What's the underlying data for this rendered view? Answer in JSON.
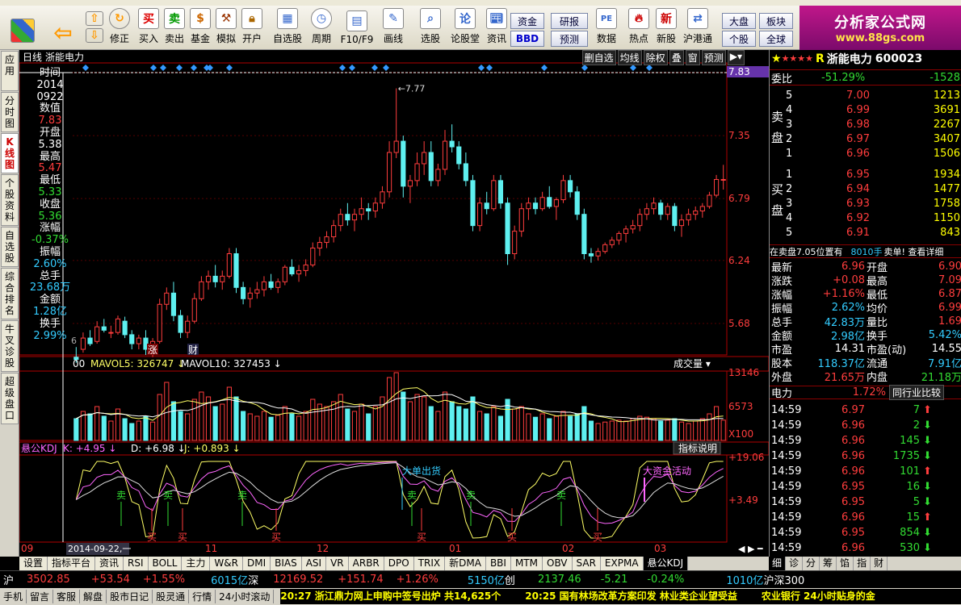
{
  "toolbar": {
    "buttons": [
      "买入",
      "卖出",
      "基金",
      "模拟",
      "开户",
      "自选股",
      "周期",
      "F10/F9",
      "画线",
      "选股",
      "论股堂",
      "资讯",
      "数据",
      "热点",
      "新股",
      "沪港通"
    ],
    "nav_buttons": [
      "修正"
    ],
    "small_buttons": [
      "资金",
      "BBD",
      "研报",
      "预测",
      "大盘",
      "板块",
      "个股",
      "全球"
    ],
    "brand_title": "分析家公式网",
    "brand_url": "www.88gs.com"
  },
  "left_tabs": [
    "应用",
    "分时图",
    "K线图",
    "个股资料",
    "自选股",
    "综合排名",
    "牛叉诊股",
    "超级盘口"
  ],
  "chart": {
    "period": "日线",
    "stock_name": "浙能电力",
    "tools": [
      "删自选",
      "均线",
      "除权",
      "叠",
      "窗",
      "预测"
    ],
    "current_price_label": "7.83",
    "high_marker": "7.77",
    "price_axis": [
      "7.91",
      "7.35",
      "6.79",
      "6.24",
      "5.68"
    ],
    "vol_axis": [
      "13146",
      "6573",
      "X100"
    ],
    "kdj_axis": [
      "+19.06",
      "+3.49"
    ],
    "date_labels": [
      "09",
      "11",
      "12",
      "01",
      "02",
      "03"
    ],
    "cursor_date": "2014-09-22,一",
    "vol_legend": {
      "mavol5": "MAVOL5: 326747",
      "mavol10": "MAVOL10: 327453",
      "title": "成交量",
      "prefix": "00"
    },
    "kdj_legend": {
      "name": "悬公KDJ",
      "k": "K: +4.95",
      "d": "D: +6.98",
      "j": "J: +0.893",
      "explain": "指标说明"
    },
    "sell_labels": [
      "卖",
      "卖",
      "卖",
      "卖",
      "卖",
      "卖"
    ],
    "buy_labels": [
      "买",
      "买",
      "买",
      "买",
      "买",
      "买"
    ],
    "annotations": [
      "大单出货",
      "大资金活动"
    ],
    "markers": [
      "涨",
      "财"
    ],
    "left_digit": "6"
  },
  "tooltip": {
    "time_label": "时间",
    "date1": "2014",
    "date2": "0922",
    "value_label": "数值",
    "value": "7.83",
    "open_label": "开盘",
    "open": "5.38",
    "high_label": "最高",
    "high": "5.47",
    "low_label": "最低",
    "low": "5.33",
    "close_label": "收盘",
    "close": "5.36",
    "change_label": "涨幅",
    "change": "-0.37%",
    "amp_label": "振幅",
    "amp": "2.60%",
    "vol_label": "总手",
    "vol": "23.68万",
    "amount_label": "金额",
    "amount": "1.28亿",
    "turn_label": "换手",
    "turn": "2.99%"
  },
  "bottom_tabs": [
    "设置",
    "指标平台",
    "资讯",
    "RSI",
    "BOLL",
    "主力",
    "W&R",
    "DMI",
    "BIAS",
    "ASI",
    "VR",
    "ARBR",
    "DPO",
    "TRIX",
    "新DMA",
    "BBI",
    "MTM",
    "OBV",
    "SAR",
    "EXPMA",
    "悬公KDJ"
  ],
  "quote": {
    "title": "浙能电力",
    "code": "600023",
    "weibi_label": "委比",
    "weibi": "-51.29%",
    "weicha": "-1528",
    "sell_label": "卖盘",
    "buy_label": "买盘",
    "asks": [
      {
        "lvl": "5",
        "p": "7.00",
        "v": "1213"
      },
      {
        "lvl": "4",
        "p": "6.99",
        "v": "3691"
      },
      {
        "lvl": "3",
        "p": "6.98",
        "v": "2267"
      },
      {
        "lvl": "2",
        "p": "6.97",
        "v": "3407"
      },
      {
        "lvl": "1",
        "p": "6.96",
        "v": "1506"
      }
    ],
    "bids": [
      {
        "lvl": "1",
        "p": "6.95",
        "v": "1934"
      },
      {
        "lvl": "2",
        "p": "6.94",
        "v": "1477"
      },
      {
        "lvl": "3",
        "p": "6.93",
        "v": "1758"
      },
      {
        "lvl": "4",
        "p": "6.92",
        "v": "1150"
      },
      {
        "lvl": "5",
        "p": "6.91",
        "v": "843"
      }
    ],
    "note": "在卖盘7.05位置有",
    "note_vol": "8010手",
    "note_end": "卖单! 查看详细",
    "stats": [
      [
        "最新",
        "6.96",
        "开盘",
        "6.90"
      ],
      [
        "涨跌",
        "+0.08",
        "最高",
        "7.09"
      ],
      [
        "涨幅",
        "+1.16%",
        "最低",
        "6.87"
      ],
      [
        "振幅",
        "2.62%",
        "均价",
        "6.99"
      ],
      [
        "总手",
        "42.83万",
        "量比",
        "1.69"
      ],
      [
        "金额",
        "2.98亿",
        "换手",
        "5.42%"
      ],
      [
        "市盈",
        "14.31",
        "市盈(动)",
        "14.55"
      ],
      [
        "股本",
        "118.37亿",
        "流通",
        "7.91亿"
      ],
      [
        "外盘",
        "21.65万",
        "内盘",
        "21.18万"
      ]
    ],
    "sector": "电力",
    "sector_change": "1.72%",
    "compare": "同行业比较",
    "ticks": [
      {
        "t": "14:59",
        "p": "6.97",
        "v": "7",
        "d": "up"
      },
      {
        "t": "14:59",
        "p": "6.96",
        "v": "2",
        "d": "down"
      },
      {
        "t": "14:59",
        "p": "6.96",
        "v": "145",
        "d": "down"
      },
      {
        "t": "14:59",
        "p": "6.96",
        "v": "1735",
        "d": "down"
      },
      {
        "t": "14:59",
        "p": "6.96",
        "v": "101",
        "d": "up"
      },
      {
        "t": "14:59",
        "p": "6.95",
        "v": "16",
        "d": "down"
      },
      {
        "t": "14:59",
        "p": "6.95",
        "v": "5",
        "d": "down"
      },
      {
        "t": "14:59",
        "p": "6.96",
        "v": "15",
        "d": "up"
      },
      {
        "t": "14:59",
        "p": "6.95",
        "v": "854",
        "d": "down"
      },
      {
        "t": "14:59",
        "p": "6.96",
        "v": "530",
        "d": "down"
      }
    ],
    "tabs": [
      "细",
      "诊",
      "分",
      "筹",
      "馅",
      "指",
      "财"
    ]
  },
  "status": {
    "sh_label": "沪",
    "sh": "3502.85",
    "sh_chg": "+53.54",
    "sh_pct": "+1.55%",
    "sh_amt": "6015亿",
    "sz_label": "深",
    "sz": "12169.52",
    "sz_chg": "+151.74",
    "sz_pct": "+1.26%",
    "sz_amt": "5150亿",
    "cy_label": "创",
    "cy": "2137.46",
    "cy_chg": "-5.21",
    "cy_pct": "-0.24%",
    "cy_amt": "1010亿",
    "hs_label": "沪深300"
  },
  "bottombar": {
    "items": [
      "手机",
      "留言",
      "客服",
      "解盘",
      "股市日记",
      "股灵通",
      "行情",
      "24小时滚动"
    ],
    "news": [
      "20:27 浙江鼎力网上申购中签号出炉 共14,625个",
      "20:25 国有林场改革方案印发 林业类企业望受益",
      "农业银行 24小时贴身的金"
    ]
  },
  "colors": {
    "up": "#ff3d3d",
    "down": "#5ef0f0",
    "bg": "#000000",
    "axis": "#b00000"
  },
  "chart_data": {
    "type": "candlestick",
    "title": "浙能电力 日线",
    "symbol": "600023",
    "x_labels": [
      "09",
      "11",
      "12",
      "01",
      "02",
      "03"
    ],
    "ylim": [
      5.4,
      7.91
    ],
    "candles": [
      [
        5.38,
        5.47,
        5.33,
        5.36
      ],
      [
        5.45,
        5.6,
        5.42,
        5.55
      ],
      [
        5.55,
        5.62,
        5.48,
        5.5
      ],
      [
        5.52,
        5.7,
        5.5,
        5.65
      ],
      [
        5.65,
        5.72,
        5.6,
        5.62
      ],
      [
        5.6,
        5.66,
        5.55,
        5.6
      ],
      [
        5.6,
        5.75,
        5.58,
        5.72
      ],
      [
        5.7,
        5.74,
        5.55,
        5.58
      ],
      [
        5.58,
        5.62,
        5.45,
        5.5
      ],
      [
        5.5,
        5.58,
        5.45,
        5.55
      ],
      [
        5.55,
        5.62,
        5.4,
        5.45
      ],
      [
        5.45,
        5.55,
        5.38,
        5.52
      ],
      [
        5.52,
        5.9,
        5.5,
        5.85
      ],
      [
        5.85,
        6.0,
        5.8,
        5.95
      ],
      [
        5.95,
        6.05,
        5.7,
        5.75
      ],
      [
        5.75,
        5.8,
        5.55,
        5.6
      ],
      [
        5.6,
        5.75,
        5.55,
        5.7
      ],
      [
        5.7,
        5.95,
        5.68,
        5.9
      ],
      [
        5.9,
        6.1,
        5.88,
        6.05
      ],
      [
        6.05,
        6.15,
        5.98,
        6.1
      ],
      [
        6.1,
        6.2,
        6.0,
        6.05
      ],
      [
        6.05,
        6.15,
        5.98,
        6.1
      ],
      [
        6.1,
        6.35,
        6.08,
        6.3
      ],
      [
        6.3,
        6.35,
        5.95,
        6.0
      ],
      [
        6.0,
        6.05,
        5.85,
        5.9
      ],
      [
        5.9,
        6.0,
        5.82,
        5.95
      ],
      [
        5.95,
        6.05,
        5.9,
        5.98
      ],
      [
        5.98,
        6.1,
        5.92,
        6.05
      ],
      [
        6.05,
        6.12,
        5.98,
        6.0
      ],
      [
        6.0,
        6.08,
        5.95,
        6.05
      ],
      [
        6.05,
        6.2,
        6.02,
        6.18
      ],
      [
        6.18,
        6.25,
        6.1,
        6.12
      ],
      [
        6.12,
        6.2,
        6.05,
        6.15
      ],
      [
        6.15,
        6.25,
        6.1,
        6.2
      ],
      [
        6.2,
        6.4,
        6.18,
        6.35
      ],
      [
        6.35,
        6.45,
        6.28,
        6.4
      ],
      [
        6.4,
        6.5,
        6.35,
        6.45
      ],
      [
        6.45,
        6.6,
        6.4,
        6.55
      ],
      [
        6.55,
        6.7,
        6.5,
        6.65
      ],
      [
        6.65,
        6.75,
        6.55,
        6.6
      ],
      [
        6.6,
        6.7,
        6.5,
        6.65
      ],
      [
        6.65,
        6.8,
        6.6,
        6.7
      ],
      [
        6.7,
        6.75,
        6.6,
        6.68
      ],
      [
        6.68,
        6.8,
        6.62,
        6.75
      ],
      [
        6.75,
        6.9,
        6.7,
        6.85
      ],
      [
        6.85,
        7.3,
        6.8,
        7.2
      ],
      [
        7.2,
        7.77,
        7.15,
        7.3
      ],
      [
        7.3,
        7.35,
        6.8,
        6.9
      ],
      [
        6.9,
        7.0,
        6.75,
        6.95
      ],
      [
        6.95,
        7.2,
        6.9,
        7.1
      ],
      [
        7.1,
        7.3,
        7.0,
        7.2
      ],
      [
        7.2,
        7.3,
        6.9,
        6.95
      ],
      [
        6.95,
        7.1,
        6.9,
        7.05
      ],
      [
        7.05,
        7.4,
        7.0,
        7.3
      ],
      [
        7.3,
        7.45,
        7.2,
        7.25
      ],
      [
        7.25,
        7.3,
        7.05,
        7.1
      ],
      [
        7.1,
        7.2,
        6.9,
        6.95
      ],
      [
        6.95,
        7.0,
        6.5,
        6.55
      ],
      [
        6.55,
        6.8,
        6.5,
        6.75
      ],
      [
        6.75,
        6.85,
        6.65,
        6.7
      ],
      [
        6.7,
        7.0,
        6.68,
        6.95
      ],
      [
        6.95,
        7.0,
        6.7,
        6.75
      ],
      [
        6.75,
        6.8,
        6.2,
        6.3
      ],
      [
        6.3,
        6.55,
        6.25,
        6.5
      ],
      [
        6.5,
        6.75,
        6.45,
        6.7
      ],
      [
        6.7,
        6.8,
        6.6,
        6.75
      ],
      [
        6.75,
        6.8,
        6.65,
        6.7
      ],
      [
        6.7,
        6.85,
        6.68,
        6.8
      ],
      [
        6.8,
        6.9,
        6.7,
        6.72
      ],
      [
        6.72,
        6.8,
        6.6,
        6.78
      ],
      [
        6.78,
        7.0,
        6.75,
        6.95
      ],
      [
        6.95,
        7.0,
        6.8,
        6.85
      ],
      [
        6.85,
        6.9,
        6.6,
        6.65
      ],
      [
        6.65,
        6.7,
        6.25,
        6.3
      ],
      [
        6.3,
        6.35,
        6.22,
        6.28
      ],
      [
        6.28,
        6.35,
        6.24,
        6.32
      ],
      [
        6.32,
        6.4,
        6.3,
        6.38
      ],
      [
        6.38,
        6.45,
        6.35,
        6.42
      ],
      [
        6.42,
        6.5,
        6.38,
        6.48
      ],
      [
        6.48,
        6.55,
        6.4,
        6.52
      ],
      [
        6.52,
        6.6,
        6.48,
        6.55
      ],
      [
        6.55,
        6.7,
        6.5,
        6.65
      ],
      [
        6.65,
        6.75,
        6.6,
        6.7
      ],
      [
        6.7,
        6.8,
        6.65,
        6.75
      ],
      [
        6.75,
        6.78,
        6.6,
        6.65
      ],
      [
        6.65,
        6.75,
        6.6,
        6.72
      ],
      [
        6.72,
        6.75,
        6.5,
        6.55
      ],
      [
        6.55,
        6.65,
        6.45,
        6.6
      ],
      [
        6.6,
        6.7,
        6.55,
        6.65
      ],
      [
        6.65,
        6.72,
        6.6,
        6.68
      ],
      [
        6.68,
        6.75,
        6.62,
        6.72
      ],
      [
        6.72,
        6.85,
        6.7,
        6.82
      ],
      [
        6.82,
        7.0,
        6.8,
        6.96
      ],
      [
        6.96,
        7.09,
        6.87,
        6.96
      ]
    ],
    "volume": [
      45,
      60,
      55,
      70,
      50,
      40,
      65,
      45,
      35,
      40,
      50,
      38,
      95,
      120,
      80,
      60,
      55,
      85,
      100,
      90,
      70,
      75,
      110,
      90,
      60,
      55,
      50,
      60,
      48,
      52,
      70,
      55,
      50,
      60,
      85,
      75,
      70,
      80,
      95,
      65,
      60,
      75,
      55,
      70,
      90,
      130,
      140,
      100,
      80,
      95,
      90,
      70,
      60,
      100,
      80,
      70,
      65,
      90,
      60,
      55,
      70,
      50,
      85,
      65,
      70,
      55,
      48,
      55,
      45,
      50,
      60,
      50,
      55,
      70,
      40,
      35,
      38,
      40,
      42,
      40,
      45,
      50,
      48,
      45,
      40,
      42,
      45,
      38,
      35,
      40,
      45,
      55,
      70,
      42
    ],
    "kdj": {
      "k": [
        4.95
      ],
      "d": [
        6.98
      ],
      "j": [
        0.893
      ]
    }
  }
}
